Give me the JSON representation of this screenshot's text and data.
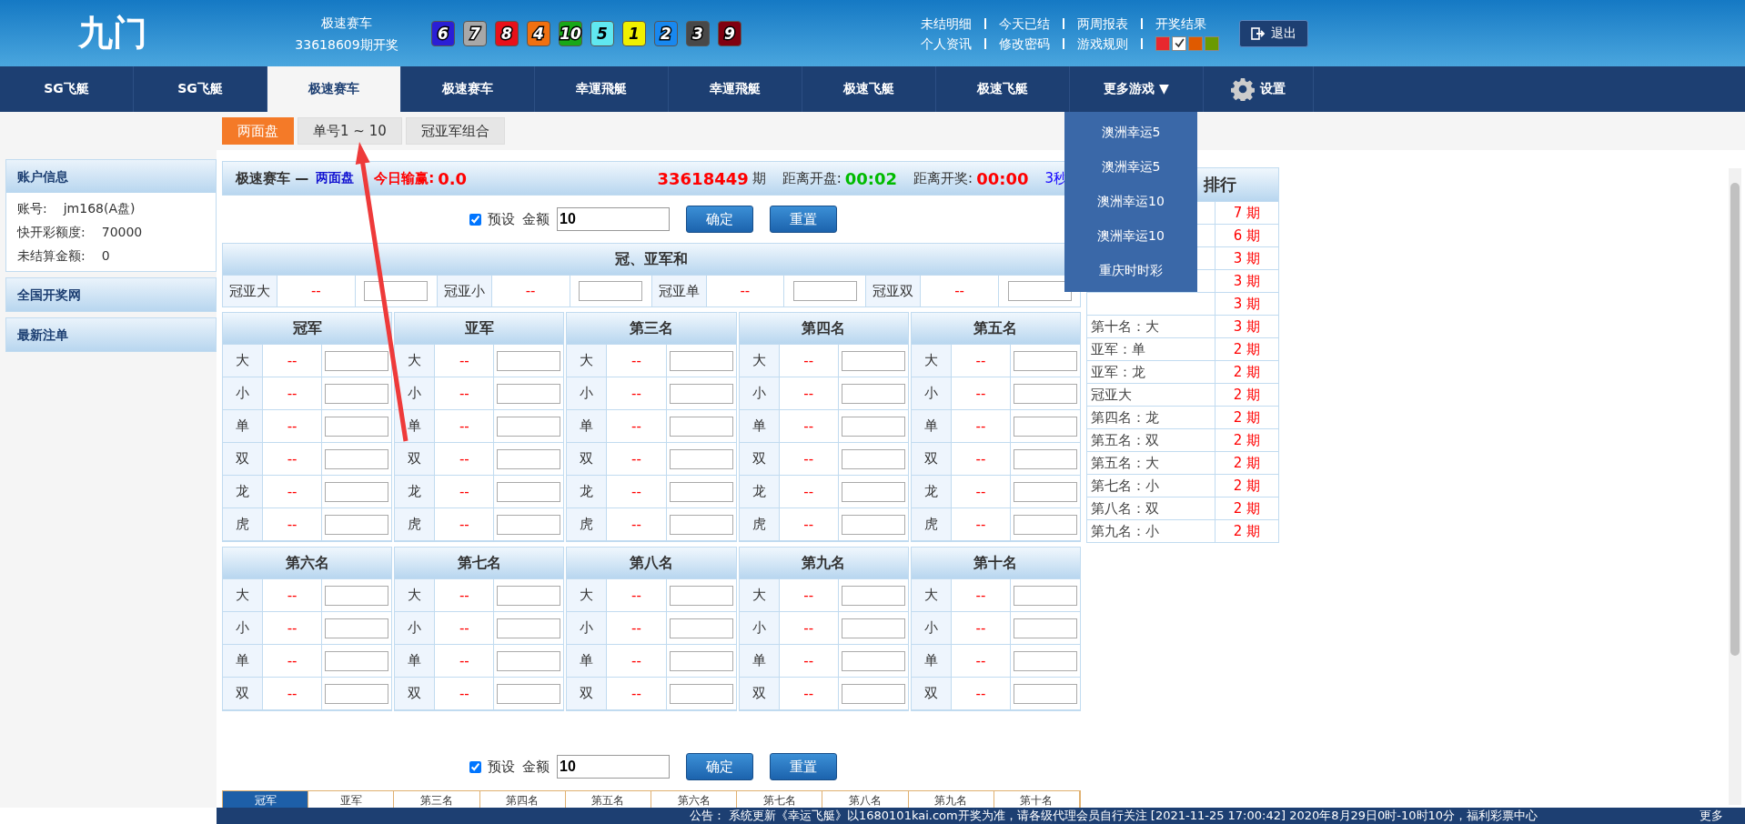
{
  "header": {
    "logo": "九门",
    "game": "极速赛车",
    "draw": "33618609期开奖",
    "balls": [
      {
        "number": "6",
        "color": "#2a1fd6"
      },
      {
        "number": "7",
        "color": "#a8a8a8"
      },
      {
        "number": "8",
        "color": "#e8101a"
      },
      {
        "number": "4",
        "color": "#f07010"
      },
      {
        "number": "10",
        "color": "#18a818"
      },
      {
        "number": "5",
        "color": "#60e8f0"
      },
      {
        "number": "1",
        "color": "#f0f000"
      },
      {
        "number": "2",
        "color": "#1888f0"
      },
      {
        "number": "3",
        "color": "#484848"
      },
      {
        "number": "9",
        "color": "#800010"
      }
    ],
    "links_top": [
      "未结明细",
      "今天已结",
      "两周报表",
      "开奖结果"
    ],
    "links_bottom": [
      "个人资讯",
      "修改密码",
      "游戏规则"
    ],
    "themes": [
      {
        "color": "#e8282e",
        "selected": false
      },
      {
        "color": "#ffffff",
        "selected": true
      },
      {
        "color": "#e05a00",
        "selected": false
      },
      {
        "color": "#6a9a00",
        "selected": false
      }
    ],
    "logout": "退出"
  },
  "nav": [
    {
      "kind": "game",
      "label": "SG飞艇",
      "selected": false
    },
    {
      "kind": "game",
      "label": "SG飞艇",
      "selected": false
    },
    {
      "kind": "game",
      "label": "极速赛车",
      "selected": true
    },
    {
      "kind": "game",
      "label": "极速赛车",
      "selected": false
    },
    {
      "kind": "game",
      "label": "幸運飛艇",
      "selected": false
    },
    {
      "kind": "game",
      "label": "幸運飛艇",
      "selected": false
    },
    {
      "kind": "game",
      "label": "极速飞艇",
      "selected": false
    },
    {
      "kind": "game",
      "label": "极速飞艇",
      "selected": false
    },
    {
      "kind": "more",
      "label": "更多游戏 ▼",
      "selected": false
    },
    {
      "kind": "settings",
      "label": "设置",
      "selected": false
    }
  ],
  "more_menu": [
    "澳洲幸运5",
    "澳洲幸运5",
    "澳洲幸运10",
    "澳洲幸运10",
    "重庆时时彩"
  ],
  "subtabs": [
    {
      "label": "两面盘",
      "selected": true
    },
    {
      "label": "单号1 ~ 10",
      "selected": false
    },
    {
      "label": "冠亚军组合",
      "selected": false
    }
  ],
  "sidebar": {
    "account_title": "账户信息",
    "account": [
      {
        "label": "账号:",
        "value": "jm168(A盘)"
      },
      {
        "label": "快开彩额度:",
        "value": "70000"
      },
      {
        "label": "未结算金额:",
        "value": "0"
      }
    ],
    "links": [
      "全国开奖网",
      "最新注单"
    ]
  },
  "info": {
    "game": "极速赛车 —",
    "mode": "两面盘",
    "profit_label": "今日输赢:",
    "profit": "0.0",
    "period": "33618449",
    "period_unit": "期",
    "open_label": "距离开盘:",
    "open_time": "00:02",
    "draw_label": "距离开奖:",
    "draw_time": "00:00",
    "refresh": "3秒"
  },
  "forms": [
    {
      "preset_label": "预设",
      "preset_checked": true,
      "amount_label": "金额",
      "amount": "10",
      "confirm": "确定",
      "reset": "重置"
    },
    {
      "preset_label": "预设",
      "preset_checked": true,
      "amount_label": "金额",
      "amount": "10",
      "confirm": "确定",
      "reset": "重置"
    }
  ],
  "sum": {
    "title": "冠、亚军和",
    "items": [
      {
        "label": "冠亚大",
        "odds": "--"
      },
      {
        "label": "冠亚小",
        "odds": "--"
      },
      {
        "label": "冠亚单",
        "odds": "--"
      },
      {
        "label": "冠亚双",
        "odds": "--"
      }
    ]
  },
  "positions": [
    {
      "title": "冠军",
      "rows": [
        {
          "label": "大",
          "odds": "--"
        },
        {
          "label": "小",
          "odds": "--"
        },
        {
          "label": "单",
          "odds": "--"
        },
        {
          "label": "双",
          "odds": "--"
        },
        {
          "label": "龙",
          "odds": "--"
        },
        {
          "label": "虎",
          "odds": "--"
        }
      ]
    },
    {
      "title": "亚军",
      "rows": [
        {
          "label": "大",
          "odds": "--"
        },
        {
          "label": "小",
          "odds": "--"
        },
        {
          "label": "单",
          "odds": "--"
        },
        {
          "label": "双",
          "odds": "--"
        },
        {
          "label": "龙",
          "odds": "--"
        },
        {
          "label": "虎",
          "odds": "--"
        }
      ]
    },
    {
      "title": "第三名",
      "rows": [
        {
          "label": "大",
          "odds": "--"
        },
        {
          "label": "小",
          "odds": "--"
        },
        {
          "label": "单",
          "odds": "--"
        },
        {
          "label": "双",
          "odds": "--"
        },
        {
          "label": "龙",
          "odds": "--"
        },
        {
          "label": "虎",
          "odds": "--"
        }
      ]
    },
    {
      "title": "第四名",
      "rows": [
        {
          "label": "大",
          "odds": "--"
        },
        {
          "label": "小",
          "odds": "--"
        },
        {
          "label": "单",
          "odds": "--"
        },
        {
          "label": "双",
          "odds": "--"
        },
        {
          "label": "龙",
          "odds": "--"
        },
        {
          "label": "虎",
          "odds": "--"
        }
      ]
    },
    {
      "title": "第五名",
      "rows": [
        {
          "label": "大",
          "odds": "--"
        },
        {
          "label": "小",
          "odds": "--"
        },
        {
          "label": "单",
          "odds": "--"
        },
        {
          "label": "双",
          "odds": "--"
        },
        {
          "label": "龙",
          "odds": "--"
        },
        {
          "label": "虎",
          "odds": "--"
        }
      ]
    },
    {
      "title": "第六名",
      "rows": [
        {
          "label": "大",
          "odds": "--"
        },
        {
          "label": "小",
          "odds": "--"
        },
        {
          "label": "单",
          "odds": "--"
        },
        {
          "label": "双",
          "odds": "--"
        }
      ]
    },
    {
      "title": "第七名",
      "rows": [
        {
          "label": "大",
          "odds": "--"
        },
        {
          "label": "小",
          "odds": "--"
        },
        {
          "label": "单",
          "odds": "--"
        },
        {
          "label": "双",
          "odds": "--"
        }
      ]
    },
    {
      "title": "第八名",
      "rows": [
        {
          "label": "大",
          "odds": "--"
        },
        {
          "label": "小",
          "odds": "--"
        },
        {
          "label": "单",
          "odds": "--"
        },
        {
          "label": "双",
          "odds": "--"
        }
      ]
    },
    {
      "title": "第九名",
      "rows": [
        {
          "label": "大",
          "odds": "--"
        },
        {
          "label": "小",
          "odds": "--"
        },
        {
          "label": "单",
          "odds": "--"
        },
        {
          "label": "双",
          "odds": "--"
        }
      ]
    },
    {
      "title": "第十名",
      "rows": [
        {
          "label": "大",
          "odds": "--"
        },
        {
          "label": "小",
          "odds": "--"
        },
        {
          "label": "单",
          "odds": "--"
        },
        {
          "label": "双",
          "odds": "--"
        }
      ]
    }
  ],
  "bottom_tabs": [
    {
      "label": "冠军",
      "selected": true
    },
    {
      "label": "亚军",
      "selected": false
    },
    {
      "label": "第三名",
      "selected": false
    },
    {
      "label": "第四名",
      "selected": false
    },
    {
      "label": "第五名",
      "selected": false
    },
    {
      "label": "第六名",
      "selected": false
    },
    {
      "label": "第七名",
      "selected": false
    },
    {
      "label": "第八名",
      "selected": false
    },
    {
      "label": "第九名",
      "selected": false
    },
    {
      "label": "第十名",
      "selected": false
    }
  ],
  "ranking": {
    "title": "排行",
    "rows": [
      {
        "count": "7 期"
      },
      {
        "count": "6 期"
      },
      {
        "count": "3 期"
      },
      {
        "count": "3 期"
      },
      {
        "count": "3 期"
      },
      {
        "label": "第十名：大",
        "count": "3 期"
      },
      {
        "label": "亚军：单",
        "count": "2 期"
      },
      {
        "label": "亚军：龙",
        "count": "2 期"
      },
      {
        "label": "冠亚大",
        "count": "2 期"
      },
      {
        "label": "第四名：龙",
        "count": "2 期"
      },
      {
        "label": "第五名：双",
        "count": "2 期"
      },
      {
        "label": "第五名：大",
        "count": "2 期"
      },
      {
        "label": "第七名：小",
        "count": "2 期"
      },
      {
        "label": "第八名：双",
        "count": "2 期"
      },
      {
        "label": "第九名：小",
        "count": "2 期"
      }
    ]
  },
  "footer": {
    "label": "公告：",
    "notice": "系统更新《幸运飞艇》以1680101kai.com开奖为准，请各级代理会员自行关注 [2021-11-25 17:00:42] 2020年8月29日0时-10时10分，福利彩票中心",
    "more": "更多"
  }
}
